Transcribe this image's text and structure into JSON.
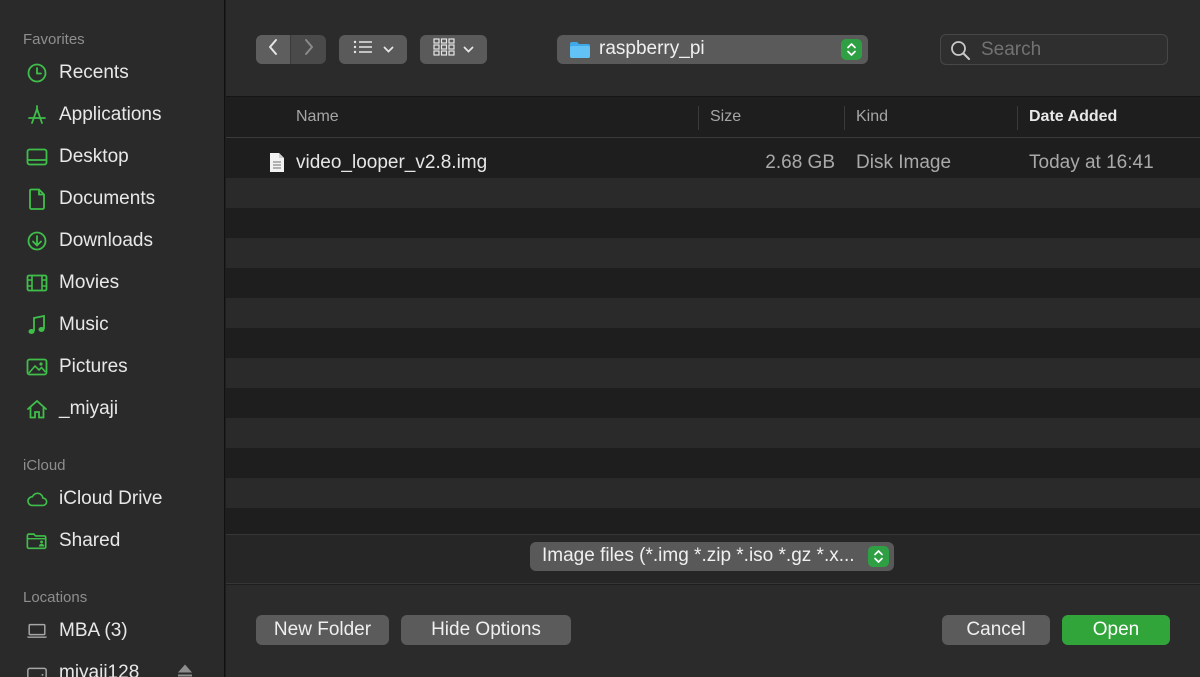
{
  "sidebar": {
    "sections": [
      {
        "title": "Favorites",
        "items": [
          {
            "label": "Recents",
            "icon": "clock-icon"
          },
          {
            "label": "Applications",
            "icon": "applications-icon"
          },
          {
            "label": "Desktop",
            "icon": "desktop-icon"
          },
          {
            "label": "Documents",
            "icon": "document-icon"
          },
          {
            "label": "Downloads",
            "icon": "download-icon"
          },
          {
            "label": "Movies",
            "icon": "film-icon"
          },
          {
            "label": "Music",
            "icon": "music-note-icon"
          },
          {
            "label": "Pictures",
            "icon": "picture-icon"
          },
          {
            "label": "_miyaji",
            "icon": "home-icon"
          }
        ]
      },
      {
        "title": "iCloud",
        "items": [
          {
            "label": "iCloud Drive",
            "icon": "cloud-icon"
          },
          {
            "label": "Shared",
            "icon": "shared-folder-icon"
          }
        ]
      },
      {
        "title": "Locations",
        "items": [
          {
            "label": "MBA (3)",
            "icon": "laptop-icon"
          },
          {
            "label": "miyaji128",
            "icon": "disk-icon"
          }
        ]
      }
    ]
  },
  "toolbar": {
    "back_icon": "chevron-left-icon",
    "forward_icon": "chevron-right-icon",
    "list_view_icon": "list-icon",
    "grid_view_icon": "grid-icon",
    "location": "raspberry_pi",
    "search_placeholder": "Search"
  },
  "columns": {
    "name": "Name",
    "size": "Size",
    "kind": "Kind",
    "date_added": "Date Added"
  },
  "files": [
    {
      "name": "video_looper_v2.8.img",
      "size": "2.68 GB",
      "kind": "Disk Image",
      "date_added": "Today at 16:41",
      "icon": "file-icon"
    }
  ],
  "filter": {
    "selected": "Image files (*.img *.zip *.iso *.gz *.x..."
  },
  "buttons": {
    "new_folder": "New Folder",
    "hide_options": "Hide Options",
    "cancel": "Cancel",
    "open": "Open"
  },
  "colors": {
    "accent": "#31a53a",
    "sidebar_icon": "#3fbf4a"
  }
}
